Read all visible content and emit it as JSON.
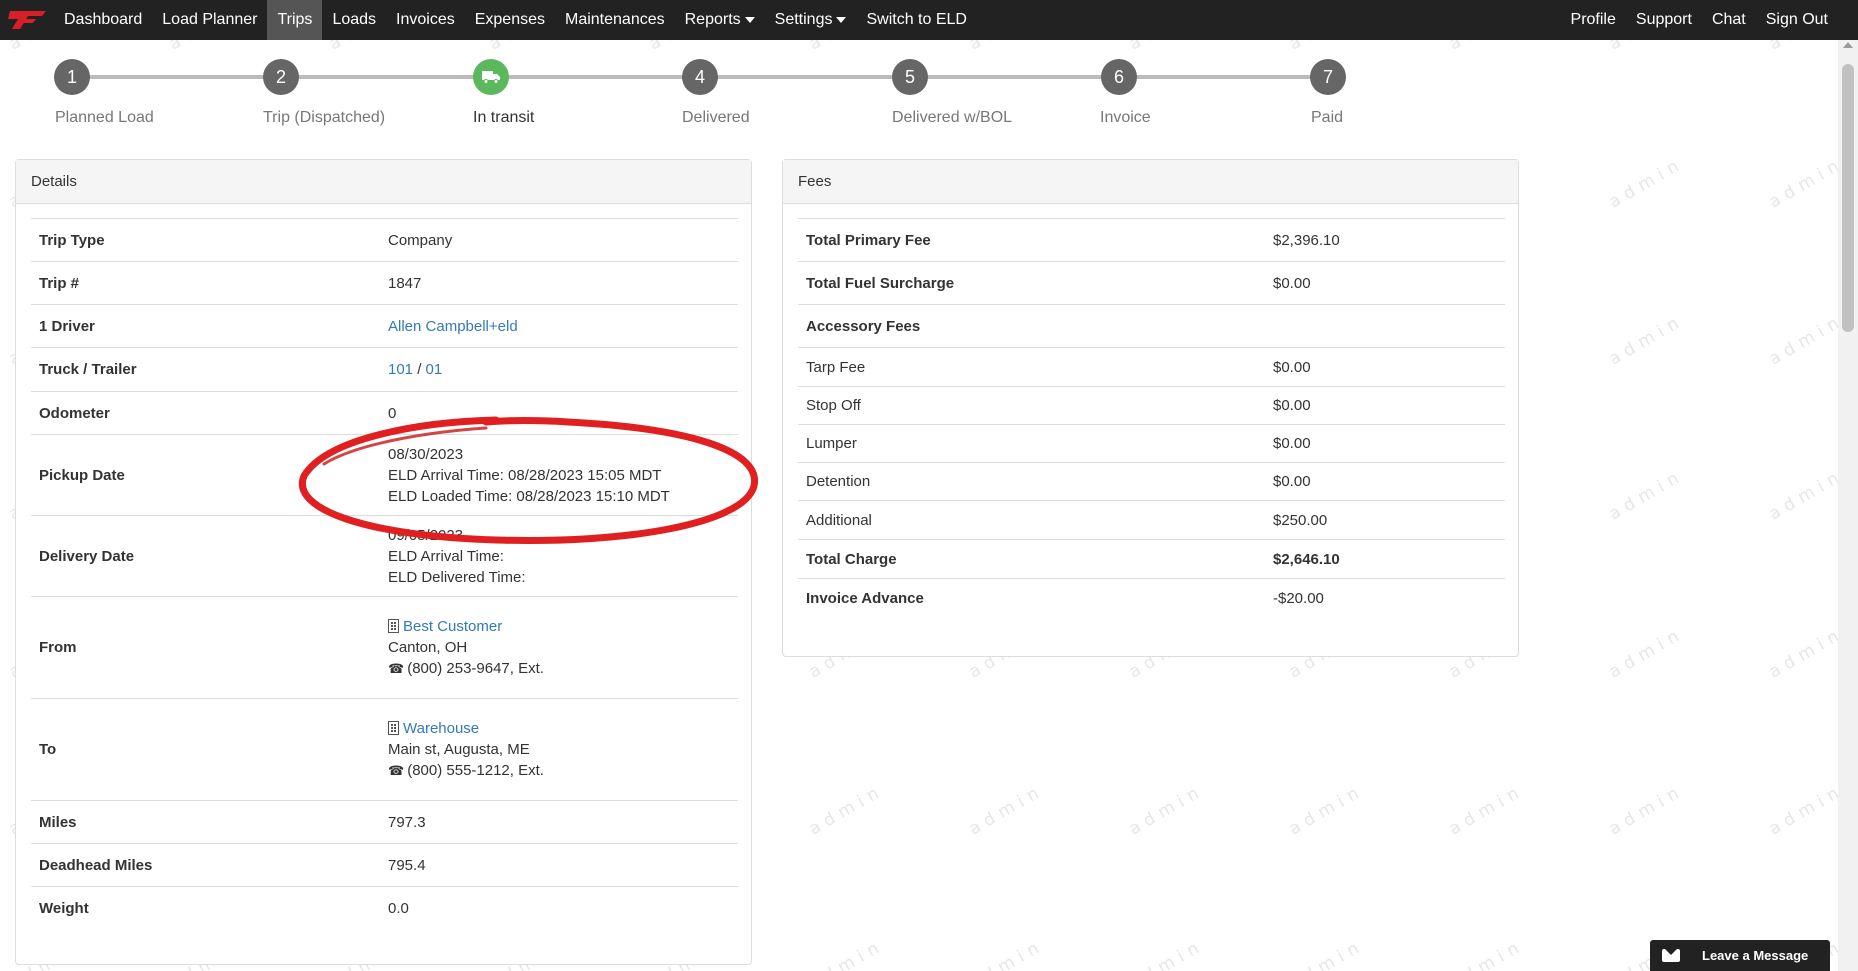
{
  "nav": {
    "items": [
      {
        "label": "Dashboard"
      },
      {
        "label": "Load Planner"
      },
      {
        "label": "Trips"
      },
      {
        "label": "Loads"
      },
      {
        "label": "Invoices"
      },
      {
        "label": "Expenses"
      },
      {
        "label": "Maintenances"
      },
      {
        "label": "Reports"
      },
      {
        "label": "Settings"
      },
      {
        "label": "Switch to ELD"
      }
    ],
    "right": [
      {
        "label": "Profile"
      },
      {
        "label": "Support"
      },
      {
        "label": "Chat"
      },
      {
        "label": "Sign Out"
      }
    ]
  },
  "stepper": {
    "steps": [
      {
        "number": "1",
        "label": "Planned Load"
      },
      {
        "number": "2",
        "label": "Trip (Dispatched)"
      },
      {
        "number": "",
        "label": "In transit"
      },
      {
        "number": "4",
        "label": "Delivered"
      },
      {
        "number": "5",
        "label": "Delivered w/BOL"
      },
      {
        "number": "6",
        "label": "Invoice"
      },
      {
        "number": "7",
        "label": "Paid"
      }
    ]
  },
  "details": {
    "title": "Details",
    "trip_type": {
      "label": "Trip Type",
      "value": "Company"
    },
    "trip_no": {
      "label": "Trip #",
      "value": "1847"
    },
    "driver": {
      "label": "1 Driver",
      "value": "Allen Campbell+eld"
    },
    "truck_trailer": {
      "label": "Truck / Trailer",
      "truck": "101",
      "sep": " / ",
      "trailer": "01"
    },
    "odometer": {
      "label": "Odometer",
      "value": "0"
    },
    "pickup": {
      "label": "Pickup Date",
      "date": "08/30/2023",
      "arrival": "ELD Arrival Time: 08/28/2023 15:05 MDT",
      "loaded": "ELD Loaded Time: 08/28/2023 15:10 MDT"
    },
    "delivery": {
      "label": "Delivery Date",
      "date": "09/05/2023",
      "arrival": "ELD Arrival Time:",
      "delivered": "ELD Delivered Time:"
    },
    "from": {
      "label": "From",
      "name": "Best Customer",
      "address": "Canton, OH",
      "phone": "(800) 253-9647, Ext."
    },
    "to": {
      "label": "To",
      "name": "Warehouse",
      "address": "Main st, Augusta, ME",
      "phone": "(800) 555-1212, Ext."
    },
    "miles": {
      "label": "Miles",
      "value": "797.3"
    },
    "deadhead": {
      "label": "Deadhead Miles",
      "value": "795.4"
    },
    "weight": {
      "label": "Weight",
      "value": "0.0"
    }
  },
  "fees": {
    "title": "Fees",
    "rows": [
      {
        "label": "Total Primary Fee",
        "value": "$2,396.10"
      },
      {
        "label": "Total Fuel Surcharge",
        "value": "$0.00"
      },
      {
        "label": "Accessory Fees",
        "value": ""
      },
      {
        "label": "Tarp Fee",
        "value": "$0.00"
      },
      {
        "label": "Stop Off",
        "value": "$0.00"
      },
      {
        "label": "Lumper",
        "value": "$0.00"
      },
      {
        "label": "Detention",
        "value": "$0.00"
      },
      {
        "label": "Additional",
        "value": "$250.00"
      },
      {
        "label": "Total Charge",
        "value": "$2,646.10"
      },
      {
        "label": "Invoice Advance",
        "value": "-$20.00"
      }
    ]
  },
  "watermark": "admin",
  "chat_widget": {
    "label": "Leave a Message"
  },
  "colors": {
    "navbar": "#222222",
    "link": "#337ab7",
    "step_done": "#5cb85c",
    "annotation": "#e02020"
  }
}
